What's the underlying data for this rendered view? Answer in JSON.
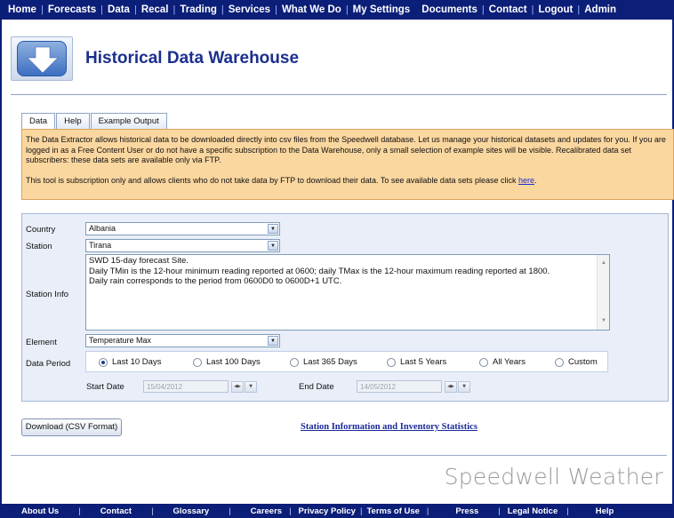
{
  "top_nav": [
    "Home",
    "Forecasts",
    "Data",
    "Recal",
    "Trading",
    "Services",
    "What We Do",
    "My Settings",
    "Documents",
    "Contact",
    "Logout",
    "Admin"
  ],
  "header": {
    "title": "Historical Data Warehouse",
    "logo_icon": "download-arrow-icon"
  },
  "tabs": [
    {
      "label": "Data",
      "active": true
    },
    {
      "label": "Help",
      "active": false
    },
    {
      "label": "Example Output",
      "active": false
    }
  ],
  "info": {
    "text1": "The Data Extractor allows historical data to be downloaded directly into csv files from the Speedwell database. Let us manage your historical datasets and updates for you. If you are logged in as a Free Content User or do not have a specific subscription to the Data Warehouse, only a small selection of example sites will be visible. Recalibrated data set subscribers: these data sets are available only via FTP.",
    "text2": "This tool is subscription only and allows clients who do not take data by FTP to download their data. To see available data sets please click ",
    "link": "here",
    "text2_end": "."
  },
  "form": {
    "country_label": "Country",
    "country_value": "Albania",
    "station_label": "Station",
    "station_value": "Tirana",
    "station_info_label": "Station Info",
    "station_info_lines": [
      "SWD 15-day forecast Site.",
      "Daily TMin is the 12-hour minimum reading reported at 0600; daily TMax is the 12-hour maximum reading reported at 1800.",
      "Daily rain corresponds to the period from 0600D0 to 0600D+1 UTC."
    ],
    "element_label": "Element",
    "element_value": "Temperature Max",
    "data_period_label": "Data Period",
    "periods": [
      {
        "label": "Last 10 Days",
        "selected": true
      },
      {
        "label": "Last 100 Days",
        "selected": false
      },
      {
        "label": "Last 365 Days",
        "selected": false
      },
      {
        "label": "Last 5 Years",
        "selected": false
      },
      {
        "label": "All Years",
        "selected": false
      },
      {
        "label": "Custom",
        "selected": false
      }
    ],
    "start_date_label": "Start Date",
    "start_date_value": "15/04/2012",
    "end_date_label": "End Date",
    "end_date_value": "14/05/2012"
  },
  "actions": {
    "download_label": "Download (CSV Format)",
    "stats_link": "Station Information and Inventory Statistics"
  },
  "brand": "Speedwell Weather",
  "bottom_nav": [
    "About Us",
    "Contact",
    "Glossary",
    "Careers",
    "Privacy Policy",
    "Terms of Use",
    "Press",
    "Legal Notice",
    "Help"
  ],
  "colors": {
    "nav": "#0b1e78",
    "info_bg": "#fbd7a0",
    "form_bg": "#e9eef8",
    "title": "#1b2f8f"
  }
}
